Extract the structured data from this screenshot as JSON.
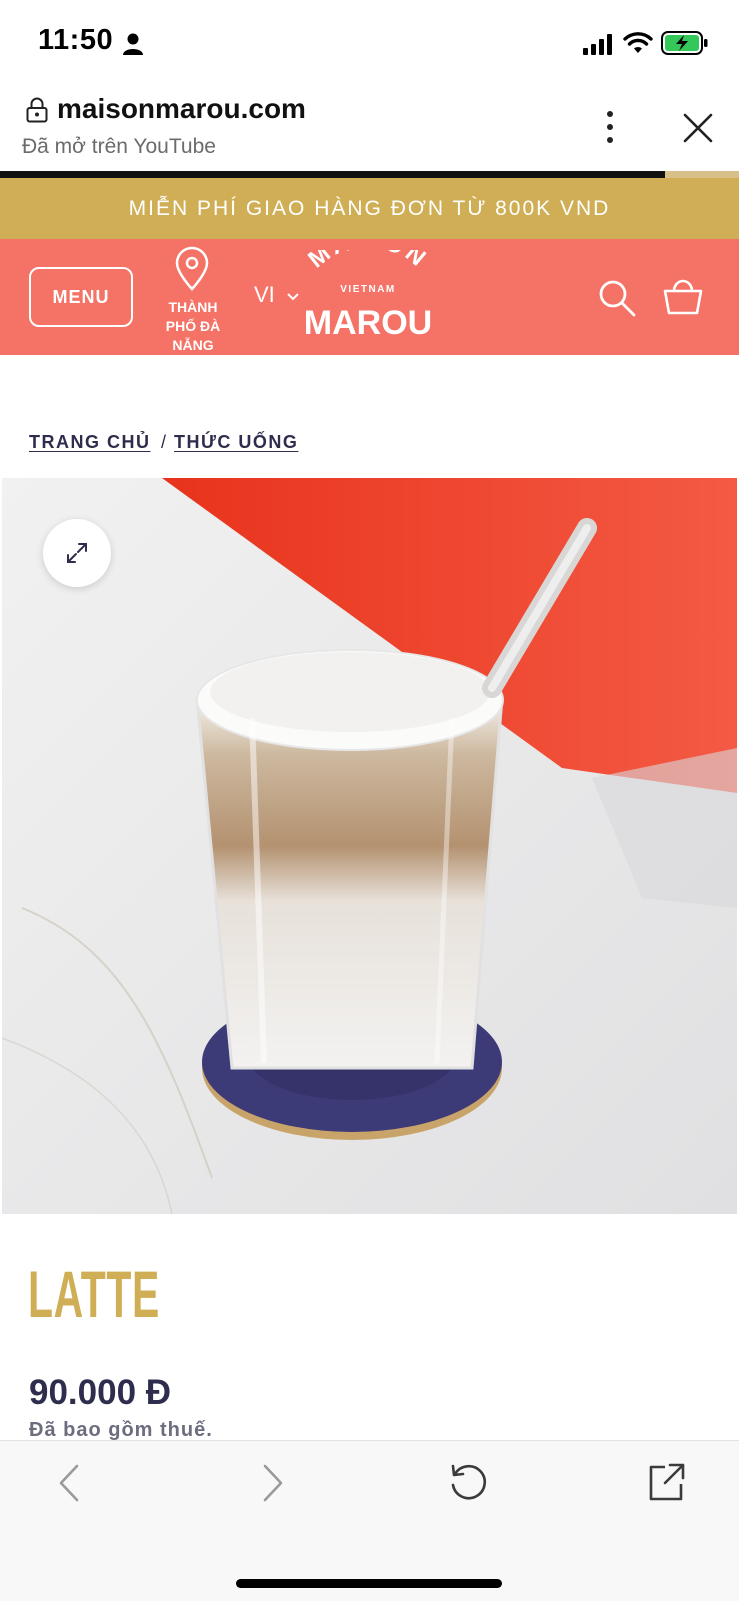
{
  "status_bar": {
    "time": "11:50"
  },
  "browser": {
    "url": "maisonmarou.com",
    "opened_in": "Đã mở trên YouTube",
    "load_progress_percent": 90
  },
  "promo_banner": {
    "text": "MIỄN PHÍ GIAO HÀNG ĐƠN TỪ 800K VND"
  },
  "header": {
    "menu_label": "MENU",
    "location_label": "THÀNH PHỐ ĐÀ NẴNG",
    "language": "VI",
    "logo": {
      "top": "MAISON",
      "middle": "VIETNAM",
      "bottom": "MAROU"
    }
  },
  "breadcrumb": {
    "home": "TRANG CHỦ",
    "separator": "/",
    "current": "THỨC UỐNG"
  },
  "product": {
    "title": "LATTE",
    "price": "90.000 Đ",
    "tax_note": "Đã bao gồm thuế."
  },
  "colors": {
    "promo_bg": "#cfae56",
    "header_bg": "#f47266",
    "title_gold": "#cfae56",
    "navy": "#2e2d4d"
  },
  "icons": {
    "status": [
      "person-icon",
      "signal-icon",
      "wifi-icon",
      "battery-charging-icon"
    ],
    "browser": [
      "lock-icon",
      "more-vertical-icon",
      "close-icon"
    ],
    "header": [
      "location-pin-icon",
      "chevron-down-icon",
      "search-icon",
      "shopping-bag-icon"
    ],
    "toolbar": [
      "back-arrow-icon",
      "forward-arrow-icon",
      "reload-icon",
      "share-external-icon"
    ]
  }
}
